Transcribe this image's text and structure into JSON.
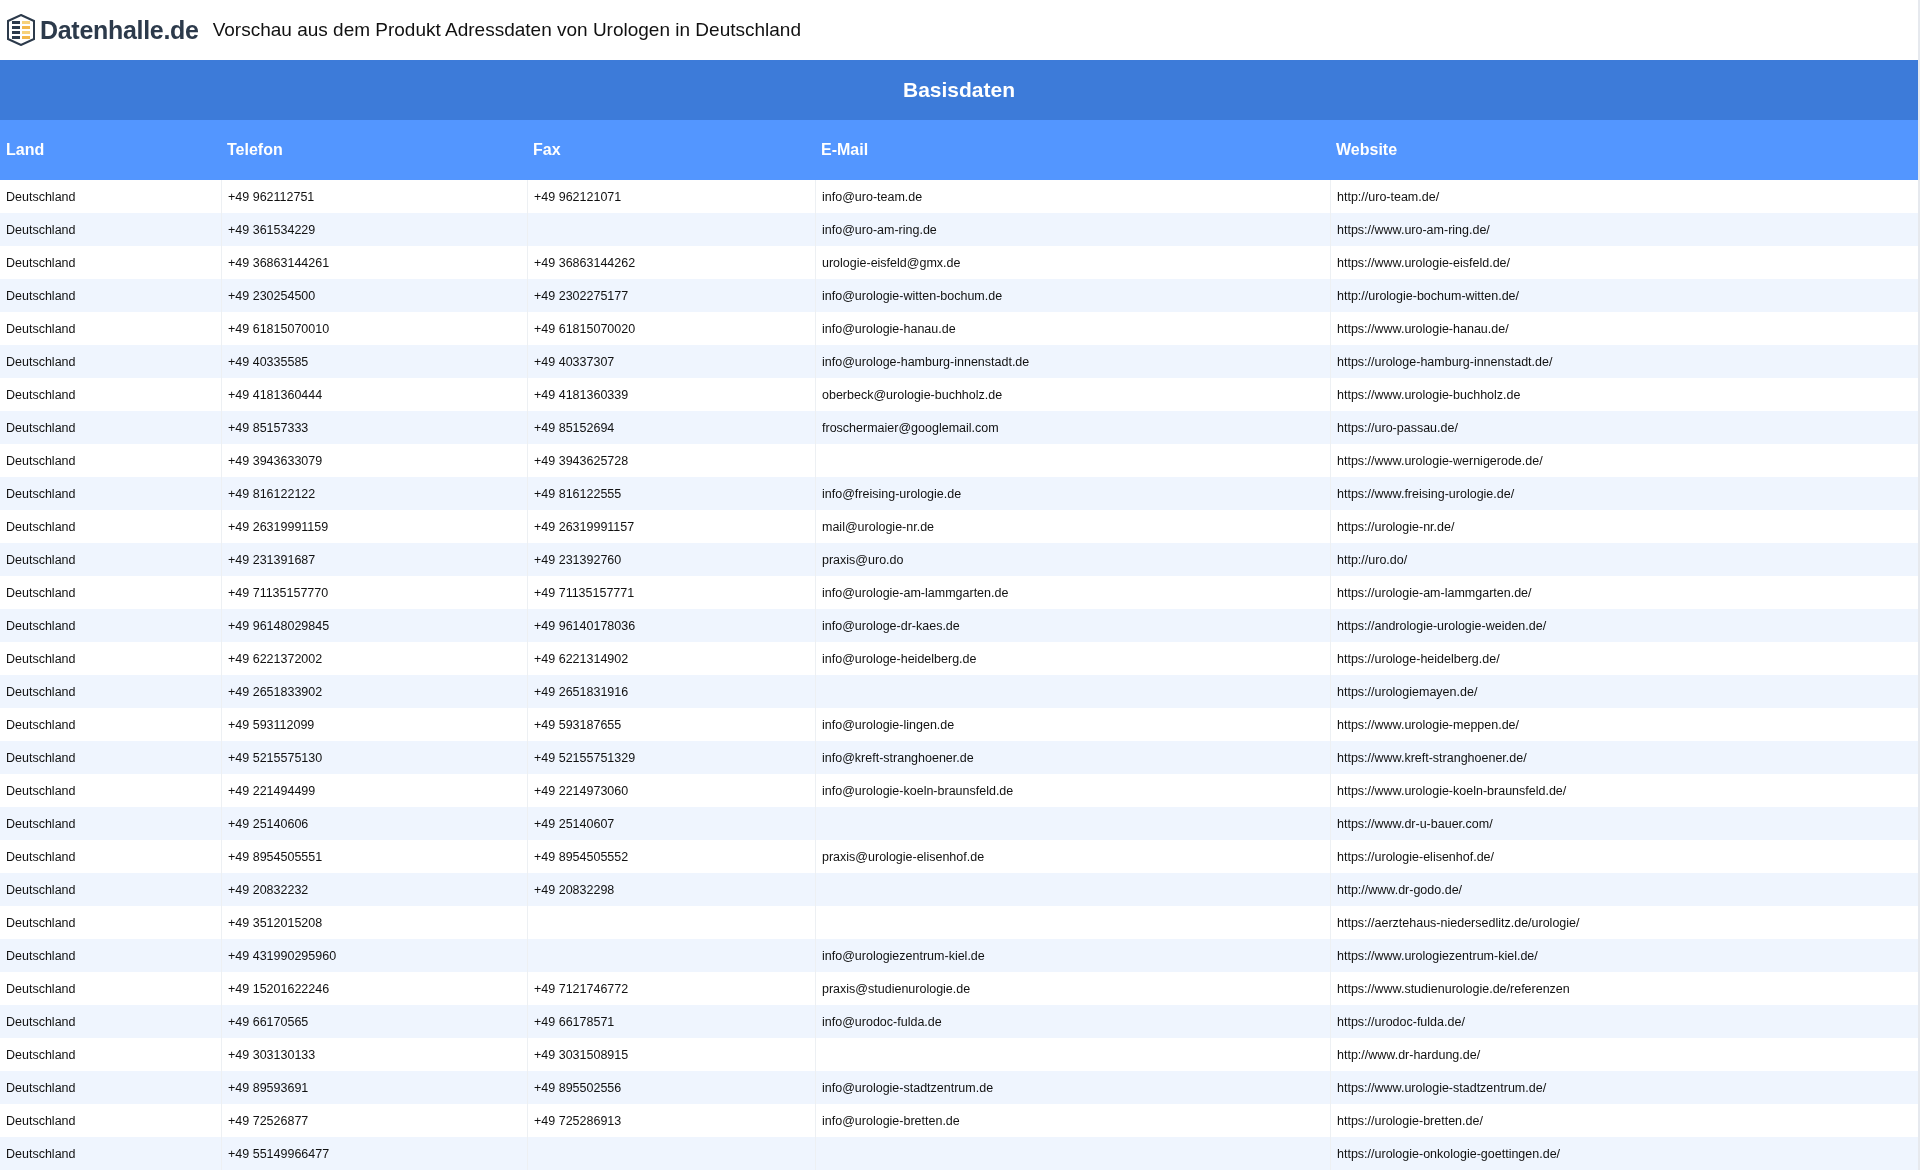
{
  "header": {
    "logo_text": "Datenhalle.de",
    "title": "Vorschau aus dem Produkt Adressdaten von Urologen in Deutschland"
  },
  "table": {
    "title": "Basisdaten",
    "columns": [
      "Land",
      "Telefon",
      "Fax",
      "E-Mail",
      "Website"
    ],
    "rows": [
      {
        "land": "Deutschland",
        "telefon": "+49 962112751",
        "fax": "+49 962121071",
        "email": "info@uro-team.de",
        "website": "http://uro-team.de/"
      },
      {
        "land": "Deutschland",
        "telefon": "+49 361534229",
        "email": "info@uro-am-ring.de",
        "website": "https://www.uro-am-ring.de/"
      },
      {
        "land": "Deutschland",
        "telefon": "+49 36863144261",
        "fax": "+49 36863144262",
        "email": "urologie-eisfeld@gmx.de",
        "website": "https://www.urologie-eisfeld.de/"
      },
      {
        "land": "Deutschland",
        "telefon": "+49 230254500",
        "fax": "+49 2302275177",
        "email": "info@urologie-witten-bochum.de",
        "website": "http://urologie-bochum-witten.de/"
      },
      {
        "land": "Deutschland",
        "telefon": "+49 61815070010",
        "fax": "+49 61815070020",
        "email": "info@urologie-hanau.de",
        "website": "https://www.urologie-hanau.de/"
      },
      {
        "land": "Deutschland",
        "telefon": "+49 40335585",
        "fax": "+49 40337307",
        "email": "info@urologe-hamburg-innenstadt.de",
        "website": "https://urologe-hamburg-innenstadt.de/"
      },
      {
        "land": "Deutschland",
        "telefon": "+49 4181360444",
        "fax": "+49 4181360339",
        "email": "oberbeck@urologie-buchholz.de",
        "website": "https://www.urologie-buchholz.de"
      },
      {
        "land": "Deutschland",
        "telefon": "+49 85157333",
        "fax": "+49 85152694",
        "email": "froschermaier@googlemail.com",
        "website": "https://uro-passau.de/"
      },
      {
        "land": "Deutschland",
        "telefon": "+49 3943633079",
        "fax": "+49 3943625728",
        "website": "https://www.urologie-wernigerode.de/"
      },
      {
        "land": "Deutschland",
        "telefon": "+49 816122122",
        "fax": "+49 816122555",
        "email": "info@freising-urologie.de",
        "website": "https://www.freising-urologie.de/"
      },
      {
        "land": "Deutschland",
        "telefon": "+49 26319991159",
        "fax": "+49 26319991157",
        "email": "mail@urologie-nr.de",
        "website": "https://urologie-nr.de/"
      },
      {
        "land": "Deutschland",
        "telefon": "+49 231391687",
        "fax": "+49 231392760",
        "email": "praxis@uro.do",
        "website": "http://uro.do/"
      },
      {
        "land": "Deutschland",
        "telefon": "+49 71135157770",
        "fax": "+49 71135157771",
        "email": "info@urologie-am-lammgarten.de",
        "website": "https://urologie-am-lammgarten.de/"
      },
      {
        "land": "Deutschland",
        "telefon": "+49 96148029845",
        "fax": "+49 96140178036",
        "email": "info@urologe-dr-kaes.de",
        "website": "https://andrologie-urologie-weiden.de/"
      },
      {
        "land": "Deutschland",
        "telefon": "+49 6221372002",
        "fax": "+49 6221314902",
        "email": "info@urologe-heidelberg.de",
        "website": "https://urologe-heidelberg.de/"
      },
      {
        "land": "Deutschland",
        "telefon": "+49 2651833902",
        "fax": "+49 2651831916",
        "website": "https://urologiemayen.de/"
      },
      {
        "land": "Deutschland",
        "telefon": "+49 593112099",
        "fax": "+49 593187655",
        "email": "info@urologie-lingen.de",
        "website": "https://www.urologie-meppen.de/"
      },
      {
        "land": "Deutschland",
        "telefon": "+49 5215575130",
        "fax": "+49 52155751329",
        "email": "info@kreft-stranghoener.de",
        "website": "https://www.kreft-stranghoener.de/"
      },
      {
        "land": "Deutschland",
        "telefon": "+49 221494499",
        "fax": "+49 2214973060",
        "email": "info@urologie-koeln-braunsfeld.de",
        "website": "https://www.urologie-koeln-braunsfeld.de/"
      },
      {
        "land": "Deutschland",
        "telefon": "+49 25140606",
        "fax": "+49 25140607",
        "website": "https://www.dr-u-bauer.com/"
      },
      {
        "land": "Deutschland",
        "telefon": "+49 8954505551",
        "fax": "+49 8954505552",
        "email": "praxis@urologie-elisenhof.de",
        "website": "https://urologie-elisenhof.de/"
      },
      {
        "land": "Deutschland",
        "telefon": "+49 20832232",
        "fax": "+49 20832298",
        "website": "http://www.dr-godo.de/"
      },
      {
        "land": "Deutschland",
        "telefon": "+49 3512015208",
        "website": "https://aerztehaus-niedersedlitz.de/urologie/"
      },
      {
        "land": "Deutschland",
        "telefon": "+49 431990295960",
        "email": "info@urologiezentrum-kiel.de",
        "website": "https://www.urologiezentrum-kiel.de/"
      },
      {
        "land": "Deutschland",
        "telefon": "+49 15201622246",
        "fax": "+49 7121746772",
        "email": "praxis@studienurologie.de",
        "website": "https://www.studienurologie.de/referenzen"
      },
      {
        "land": "Deutschland",
        "telefon": "+49 66170565",
        "fax": "+49 66178571",
        "email": "info@urodoc-fulda.de",
        "website": "https://urodoc-fulda.de/"
      },
      {
        "land": "Deutschland",
        "telefon": "+49 303130133",
        "fax": "+49 3031508915",
        "website": "http://www.dr-hardung.de/"
      },
      {
        "land": "Deutschland",
        "telefon": "+49 89593691",
        "fax": "+49 895502556",
        "email": "info@urologie-stadtzentrum.de",
        "website": "https://www.urologie-stadtzentrum.de/"
      },
      {
        "land": "Deutschland",
        "telefon": "+49 72526877",
        "fax": "+49 725286913",
        "email": "info@urologie-bretten.de",
        "website": "https://urologie-bretten.de/"
      },
      {
        "land": "Deutschland",
        "telefon": "+49 55149966477",
        "website": "https://urologie-onkologie-goettingen.de/"
      }
    ]
  }
}
